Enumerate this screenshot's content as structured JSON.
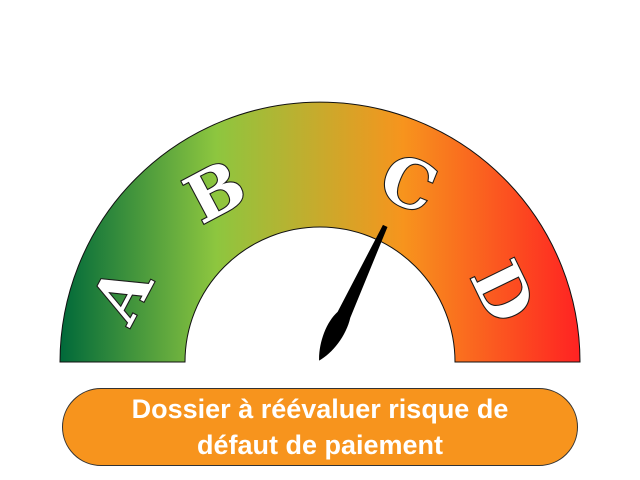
{
  "gauge": {
    "labels": [
      "A",
      "B",
      "C",
      "D"
    ],
    "needle_fraction": 0.64,
    "colors": {
      "start": "#00693A",
      "mid_green": "#8DC63F",
      "mid_orange": "#F7941D",
      "end": "#FF2222",
      "needle": "#000000"
    }
  },
  "banner": {
    "line1": "Dossier à réévaluer risque de",
    "line2": "défaut de paiement",
    "color": "#F7941D"
  }
}
